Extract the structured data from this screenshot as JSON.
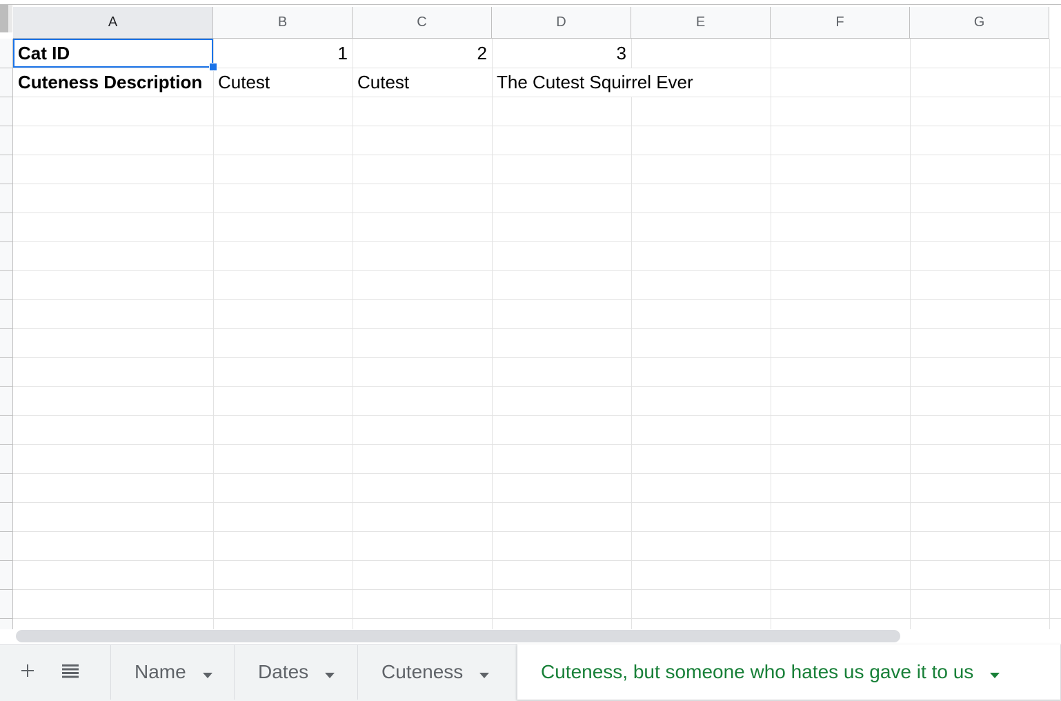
{
  "columns": [
    "A",
    "B",
    "C",
    "D",
    "E",
    "F",
    "G"
  ],
  "rows": [
    {
      "a": "Cat ID",
      "b": "1",
      "c": "2",
      "d": "3"
    },
    {
      "a": "Cuteness Description",
      "b": "Cutest",
      "c": "Cutest",
      "d": "The Cutest Squirrel Ever"
    }
  ],
  "selected_cell": "A1",
  "sheet_tabs": [
    {
      "label": "Name",
      "active": false
    },
    {
      "label": "Dates",
      "active": false
    },
    {
      "label": "Cuteness",
      "active": false
    },
    {
      "label": "Cuteness, but someone who hates us gave it to us",
      "active": true
    }
  ],
  "icons": {
    "add_sheet": "plus-icon",
    "all_sheets": "list-icon",
    "tab_menu": "caret-down-icon"
  },
  "colors": {
    "selection": "#1a73e8",
    "active_tab_text": "#188038",
    "inactive_tab_text": "#5f6368"
  }
}
